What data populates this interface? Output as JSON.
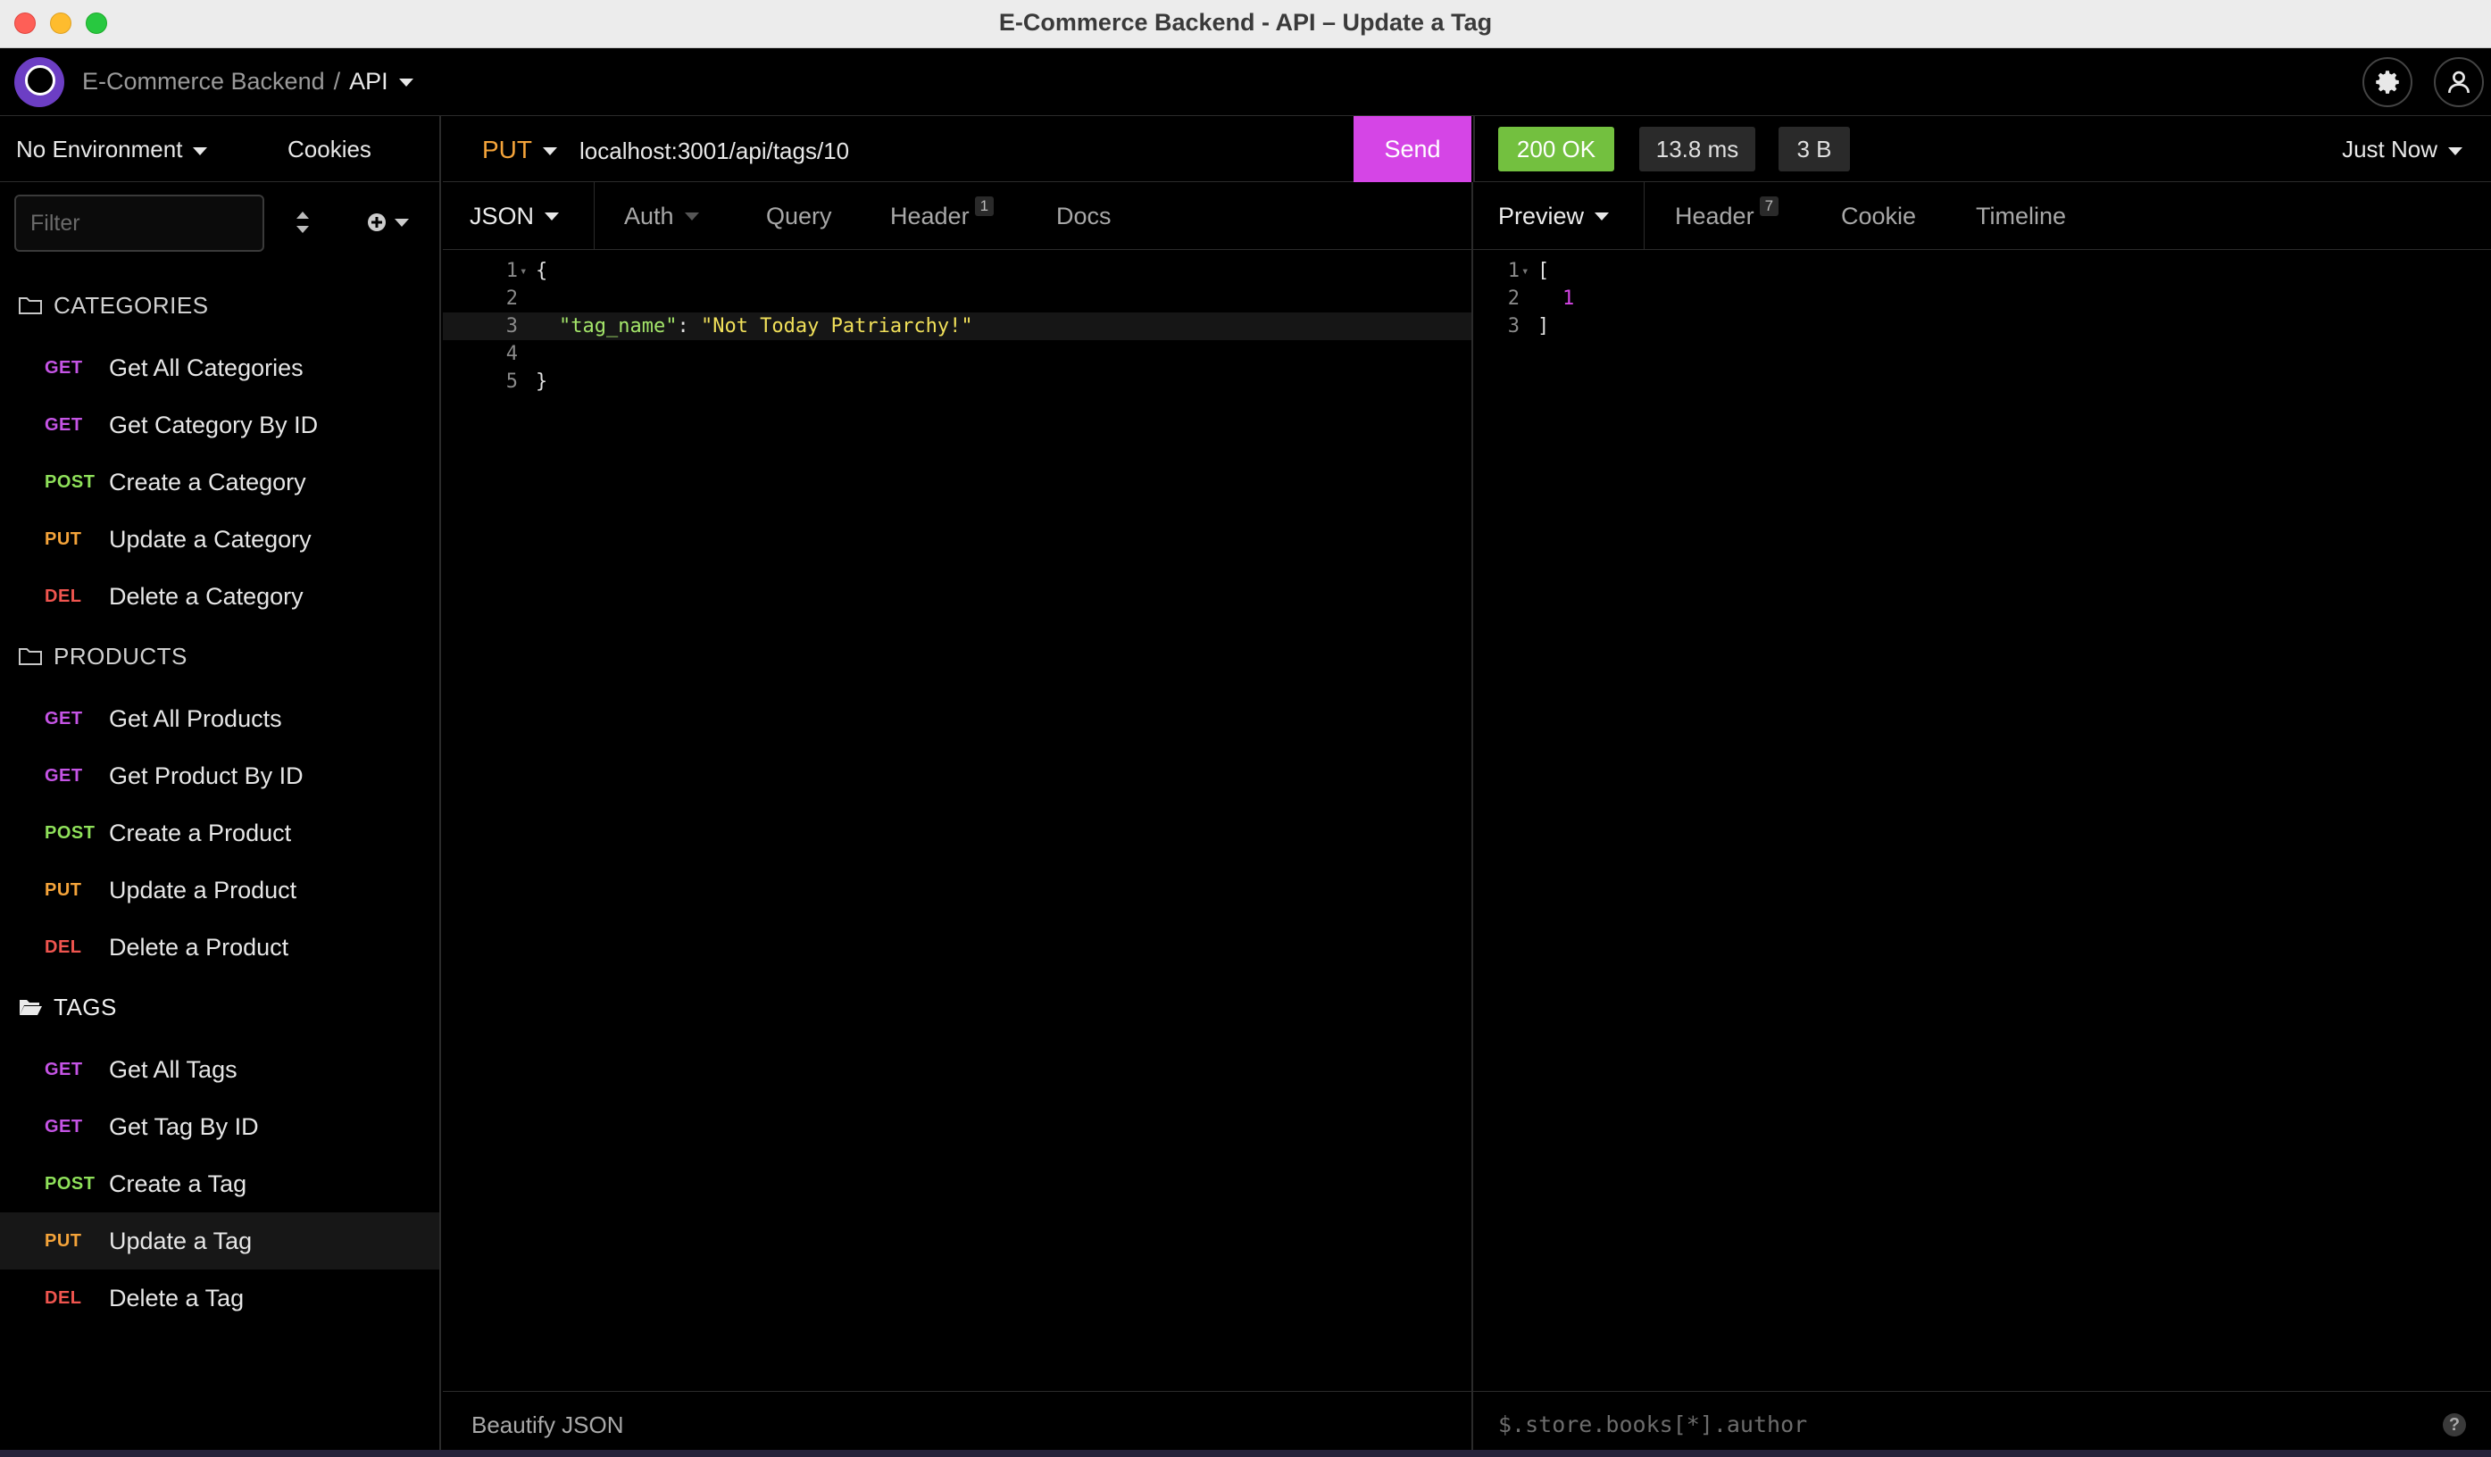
{
  "window": {
    "title": "E-Commerce Backend - API – Update a Tag"
  },
  "header": {
    "project": "E-Commerce Backend",
    "separator": "/",
    "document": "API"
  },
  "sidebar": {
    "environment": "No Environment",
    "cookies": "Cookies",
    "filter_placeholder": "Filter",
    "folders": [
      {
        "name": "CATEGORIES",
        "requests": [
          {
            "method": "GET",
            "name": "Get All Categories"
          },
          {
            "method": "GET",
            "name": "Get Category By ID"
          },
          {
            "method": "POST",
            "name": "Create a Category"
          },
          {
            "method": "PUT",
            "name": "Update a Category"
          },
          {
            "method": "DEL",
            "name": "Delete a Category"
          }
        ]
      },
      {
        "name": "PRODUCTS",
        "requests": [
          {
            "method": "GET",
            "name": "Get All Products"
          },
          {
            "method": "GET",
            "name": "Get Product By ID"
          },
          {
            "method": "POST",
            "name": "Create a Product"
          },
          {
            "method": "PUT",
            "name": "Update a Product"
          },
          {
            "method": "DEL",
            "name": "Delete a Product"
          }
        ]
      },
      {
        "name": "TAGS",
        "requests": [
          {
            "method": "GET",
            "name": "Get All Tags"
          },
          {
            "method": "GET",
            "name": "Get Tag By ID"
          },
          {
            "method": "POST",
            "name": "Create a Tag"
          },
          {
            "method": "PUT",
            "name": "Update a Tag"
          },
          {
            "method": "DEL",
            "name": "Delete a Tag"
          }
        ]
      }
    ]
  },
  "request": {
    "method": "PUT",
    "url": "localhost:3001/api/tags/10",
    "send_label": "Send",
    "tabs": {
      "body": "JSON",
      "auth": "Auth",
      "query": "Query",
      "header": "Header",
      "header_count": "1",
      "docs": "Docs"
    },
    "body_lines": [
      {
        "n": "1",
        "text": "{"
      },
      {
        "n": "2",
        "text": ""
      },
      {
        "n": "3",
        "key": "\"tag_name\"",
        "colon": ": ",
        "value": "\"Not Today Patriarchy!\""
      },
      {
        "n": "4",
        "text": ""
      },
      {
        "n": "5",
        "text": "}"
      }
    ],
    "beautify": "Beautify JSON"
  },
  "response": {
    "status": "200 OK",
    "time": "13.8 ms",
    "size": "3 B",
    "when": "Just Now",
    "tabs": {
      "preview": "Preview",
      "header": "Header",
      "header_count": "7",
      "cookie": "Cookie",
      "timeline": "Timeline"
    },
    "body_lines": [
      {
        "n": "1",
        "text": "["
      },
      {
        "n": "2",
        "value": "1"
      },
      {
        "n": "3",
        "text": "]"
      }
    ],
    "filter_placeholder": "$.store.books[*].author",
    "help": "?"
  },
  "colors": {
    "get": "#c554e5",
    "post": "#8fe15a",
    "put": "#f5a43a",
    "del": "#f0554f",
    "send": "#d545e6",
    "ok": "#73c03f"
  }
}
